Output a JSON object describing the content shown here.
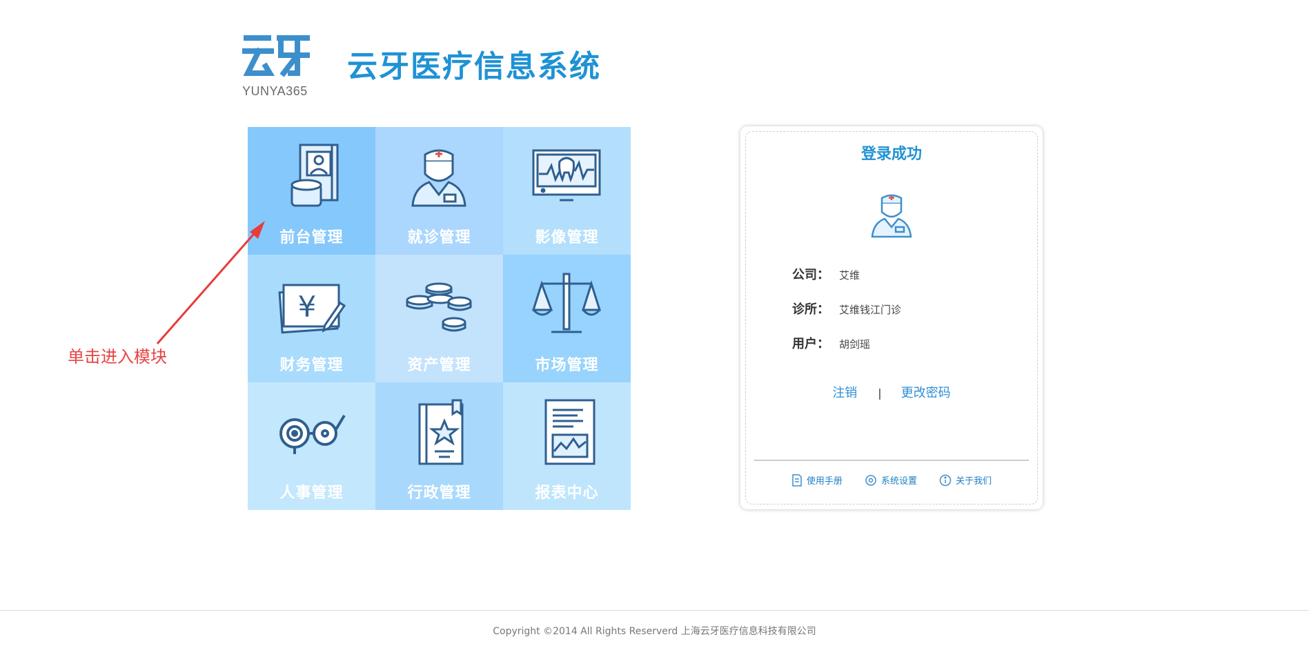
{
  "header": {
    "logo_sub": "YUNYA365",
    "title": "云牙医疗信息系统"
  },
  "modules": [
    {
      "label": "前台管理",
      "icon": "reception-icon",
      "bg": "#85c8fb"
    },
    {
      "label": "就诊管理",
      "icon": "doctor-icon",
      "bg": "#abd6fd"
    },
    {
      "label": "影像管理",
      "icon": "dental-xray-icon",
      "bg": "#b3dffd"
    },
    {
      "label": "财务管理",
      "icon": "finance-icon",
      "bg": "#a9dbfd"
    },
    {
      "label": "资产管理",
      "icon": "coins-icon",
      "bg": "#c3e3fd"
    },
    {
      "label": "市场管理",
      "icon": "scale-icon",
      "bg": "#97d3fd"
    },
    {
      "label": "人事管理",
      "icon": "glasses-icon",
      "bg": "#c3e7fd"
    },
    {
      "label": "行政管理",
      "icon": "admin-book-icon",
      "bg": "#a9d8fd"
    },
    {
      "label": "报表中心",
      "icon": "report-icon",
      "bg": "#bfe5fd"
    }
  ],
  "annotation": {
    "text": "单击进入模块"
  },
  "login": {
    "title": "登录成功",
    "company_label": "公司：",
    "company": "艾维",
    "clinic_label": "诊所：",
    "clinic": "艾维钱江门诊",
    "user_label": "用户：",
    "user": "胡剑瑶",
    "logout": "注销",
    "separator": "|",
    "change_password": "更改密码",
    "footer": {
      "manual": "使用手册",
      "settings": "系统设置",
      "about": "关于我们"
    }
  },
  "footer": {
    "copyright": "Copyright ©2014 All Rights Reserverd 上海云牙医疗信息科技有限公司"
  }
}
